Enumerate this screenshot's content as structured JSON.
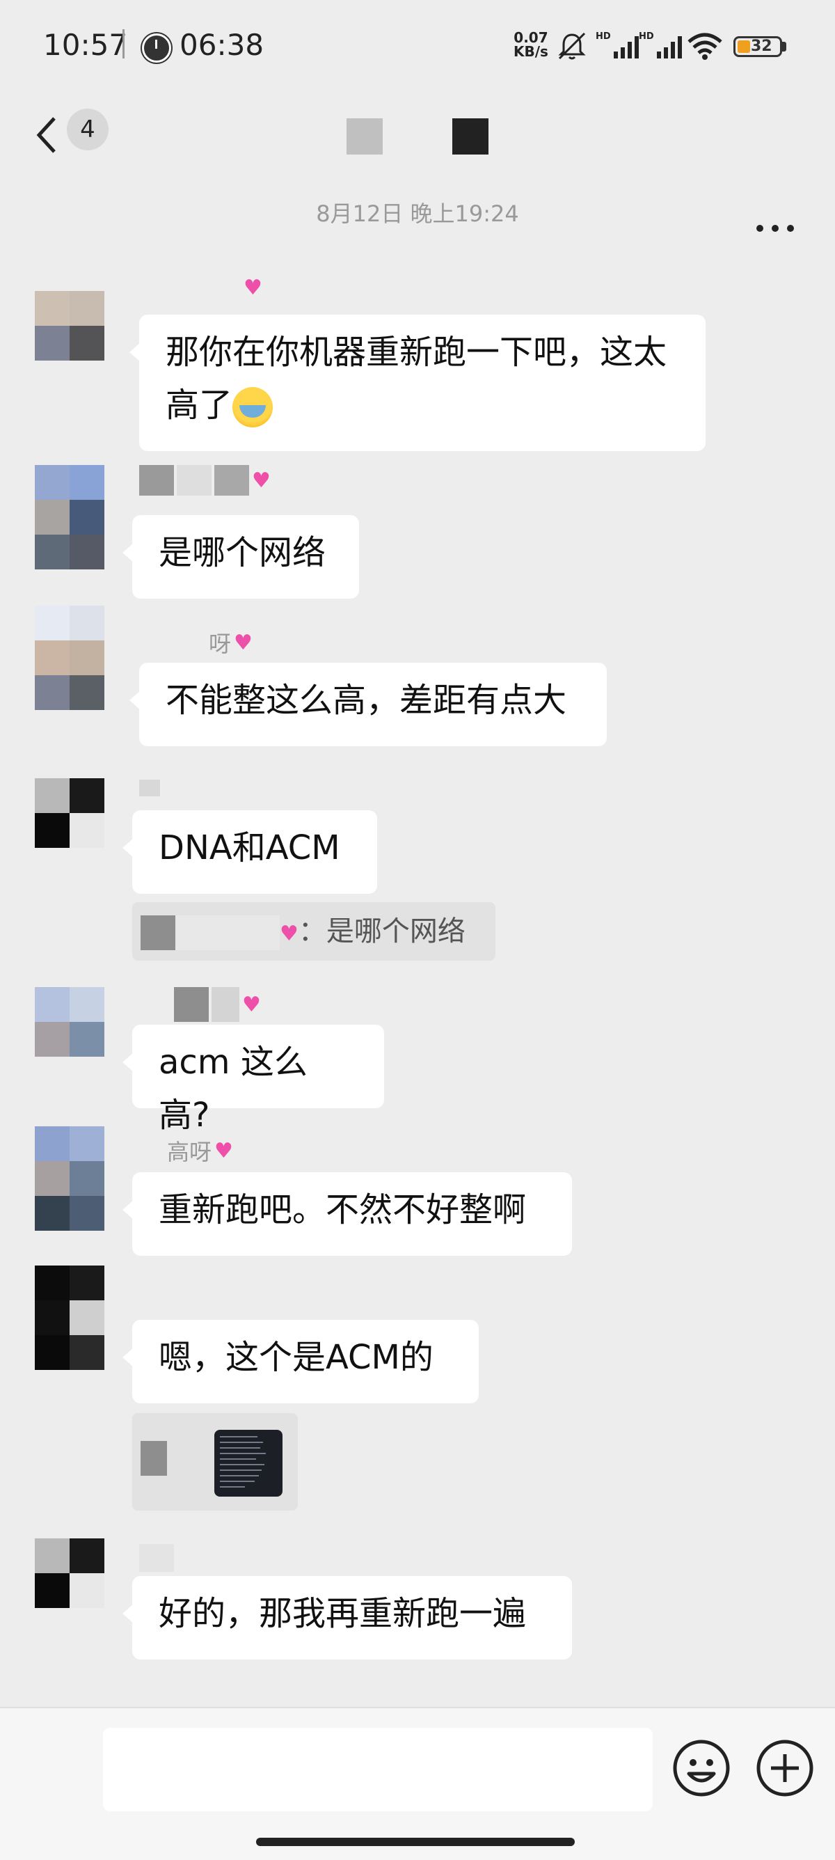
{
  "status_bar": {
    "time": "10:57",
    "clock_time": "06:38",
    "net_speed_value": "0.07",
    "net_speed_unit": "KB/s",
    "signal_label": "HD",
    "battery": "32"
  },
  "nav": {
    "unread_count": "4"
  },
  "chat": {
    "timestamp": "8月12日 晚上19:24",
    "messages": [
      {
        "text": "那你在你机器重新跑一下吧，这太高了"
      },
      {
        "text": "是哪个网络"
      },
      {
        "nick": "呀",
        "text": "不能整这么高，差距有点大"
      },
      {
        "text": "DNA和ACM",
        "quote": "：是哪个网络"
      },
      {
        "text": "acm 这么高?"
      },
      {
        "nick": "高呀",
        "text": "重新跑吧。不然不好整啊"
      },
      {
        "text": "嗯，这个是ACM的"
      },
      {
        "text": "好的，那我再重新跑一遍"
      }
    ]
  },
  "colors": {
    "heart": "#ee4fa8",
    "background": "#ededed",
    "bubble": "#ffffff"
  }
}
